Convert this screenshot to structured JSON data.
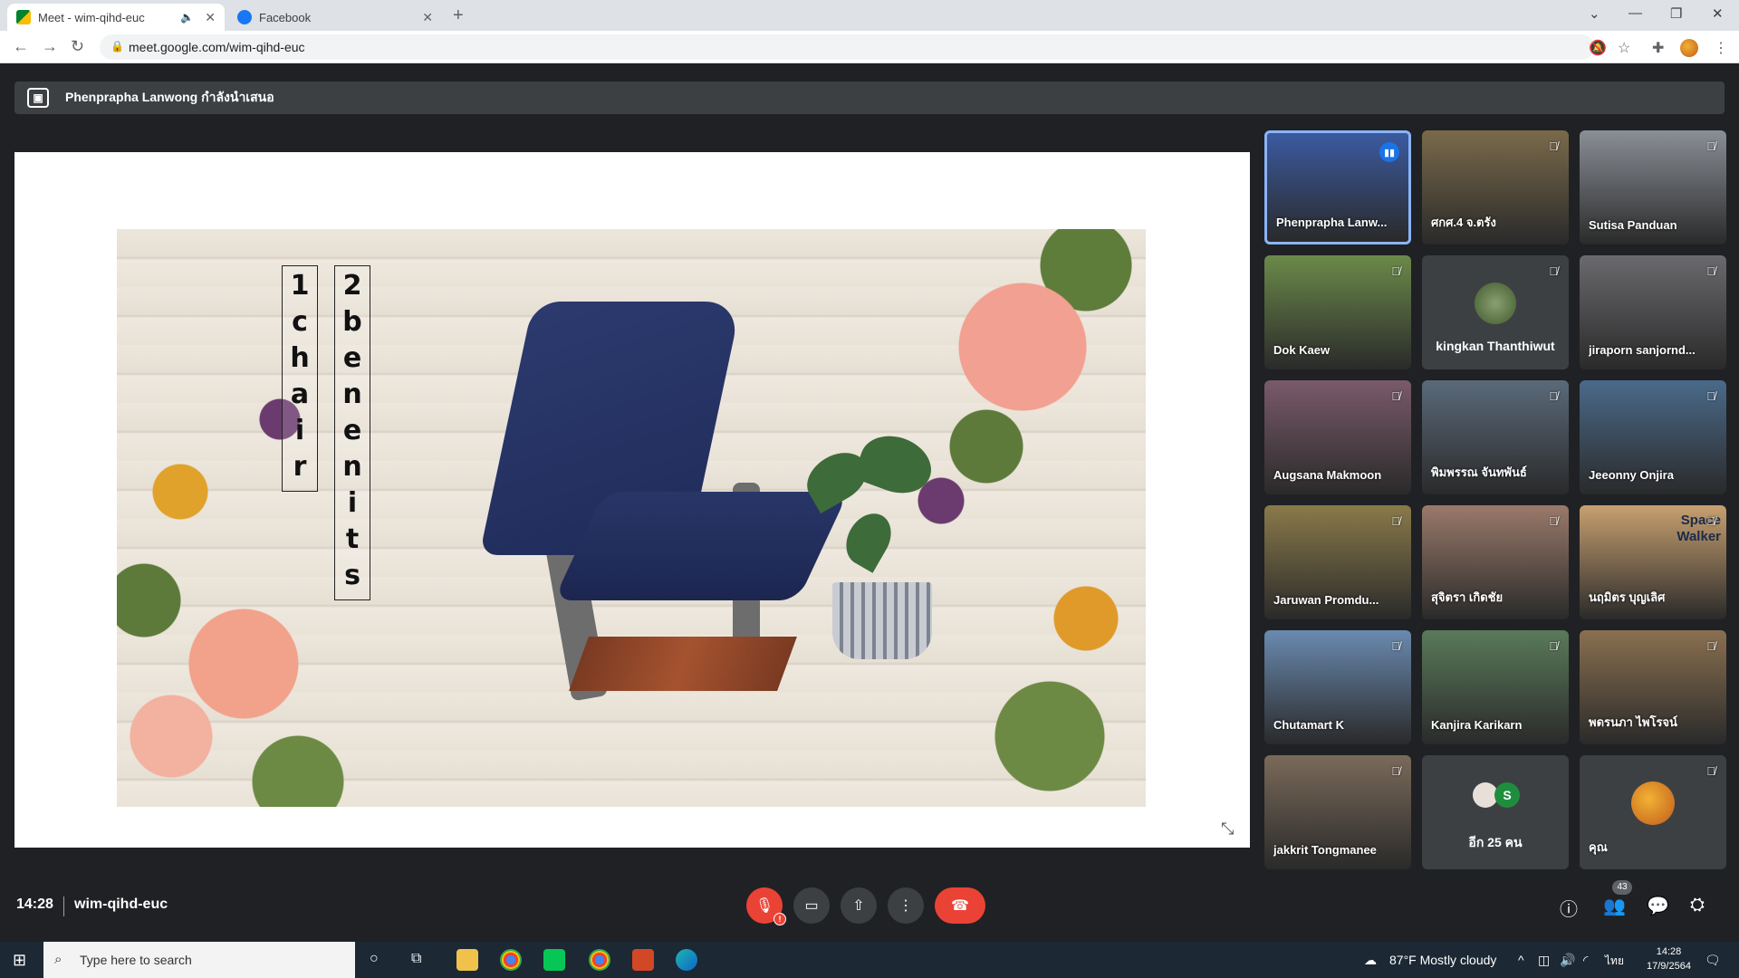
{
  "browser": {
    "tabs": [
      {
        "title": "Meet - wim-qihd-euc",
        "active": true
      },
      {
        "title": "Facebook",
        "active": false
      }
    ],
    "url": "meet.google.com/wim-qihd-euc"
  },
  "presenter": {
    "text": "Phenprapha Lanwong กำลังนำเสนอ"
  },
  "slide": {
    "word1": [
      "1",
      "c",
      "h",
      "a",
      "i",
      "r"
    ],
    "word2": [
      "2",
      "b",
      "e",
      "n",
      "e",
      "n",
      "i",
      "t",
      "s"
    ]
  },
  "participants": [
    {
      "name": "Phenprapha Lanw...",
      "speaking": true,
      "bg": "#3b5aa0"
    },
    {
      "name": "ศกศ.4 จ.ตรัง",
      "speaking": false,
      "bg": "#7a6a4a"
    },
    {
      "name": "Sutisa Panduan",
      "speaking": false,
      "bg": "#8a8f96"
    },
    {
      "name": "Dok Kaew",
      "speaking": false,
      "bg": "#6b8a4a"
    },
    {
      "name": "kingkan Thanthiwut",
      "speaking": false,
      "bg": "#3c4043",
      "avatar": true
    },
    {
      "name": "jiraporn sanjornd...",
      "speaking": false,
      "bg": "#6a6a6e"
    },
    {
      "name": "Augsana Makmoon",
      "speaking": false,
      "bg": "#7a5a6a"
    },
    {
      "name": "พิมพรรณ จันทพันธ์",
      "speaking": false,
      "bg": "#5a6a7a"
    },
    {
      "name": "Jeeonny Onjira",
      "speaking": false,
      "bg": "#4a6a8a"
    },
    {
      "name": "Jaruwan Promdu...",
      "speaking": false,
      "bg": "#8a7a4a"
    },
    {
      "name": "สุจิตรา เกิดชัย",
      "speaking": false,
      "bg": "#9a7a6a"
    },
    {
      "name": "นฤมิตร บุญเลิศ",
      "speaking": false,
      "bg": "#c8a070",
      "overlay": "Space Walker"
    },
    {
      "name": "Chutamart K",
      "speaking": false,
      "bg": "#6a8ab0"
    },
    {
      "name": "Kanjira Karikarn",
      "speaking": false,
      "bg": "#5a7a5a"
    },
    {
      "name": "พดรนภา ไพโรจน์",
      "speaking": false,
      "bg": "#8a7050"
    },
    {
      "name": "jakkrit Tongmanee",
      "speaking": false,
      "bg": "#7a6a5a"
    },
    {
      "name": "อีก 25 คน",
      "speaking": false,
      "bg": "#3c4043",
      "others": true,
      "badge": "S"
    },
    {
      "name": "คุณ",
      "speaking": false,
      "bg": "#3c4043",
      "self": true
    }
  ],
  "meeting": {
    "time": "14:28",
    "code": "wim-qihd-euc",
    "people_count": "43"
  },
  "taskbar": {
    "search_placeholder": "Type here to search",
    "weather": "87°F  Mostly cloudy",
    "lang": "ไทย",
    "time": "14:28",
    "date": "17/9/2564"
  }
}
